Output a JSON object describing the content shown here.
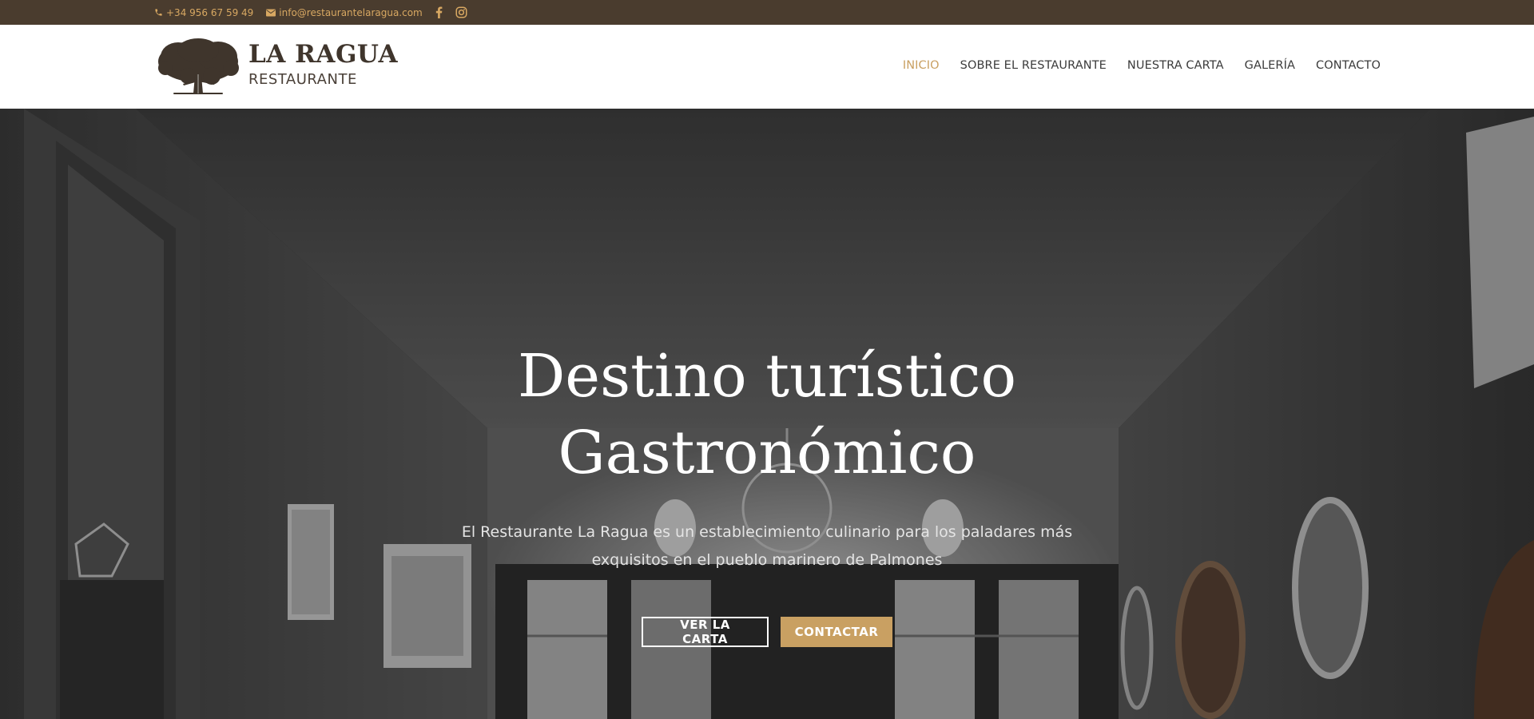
{
  "topbar": {
    "phone": "+34 956 67 59 49",
    "email": "info@restaurantelaragua.com",
    "icons": [
      "phone-icon",
      "mail-icon",
      "facebook-icon",
      "instagram-icon"
    ]
  },
  "logo": {
    "title": "LA RAGUA",
    "subtitle": "RESTAURANTE"
  },
  "nav": {
    "items": [
      {
        "label": "INICIO",
        "active": true
      },
      {
        "label": "SOBRE EL RESTAURANTE",
        "active": false
      },
      {
        "label": "NUESTRA CARTA",
        "active": false
      },
      {
        "label": "GALERÍA",
        "active": false
      },
      {
        "label": "CONTACTO",
        "active": false
      }
    ]
  },
  "hero": {
    "title_line1": "Destino turístico",
    "title_line2": "Gastronómico",
    "description": "El Restaurante La Ragua es un establecimiento culinario para los paladares más exquisitos en el pueblo marinero de Palmones",
    "buttons": {
      "primary": "VER LA CARTA",
      "secondary": "CONTACTAR"
    }
  },
  "colors": {
    "topbar_bg": "#4a3c2e",
    "accent": "#c9a062",
    "brand_text": "#3f352c"
  }
}
